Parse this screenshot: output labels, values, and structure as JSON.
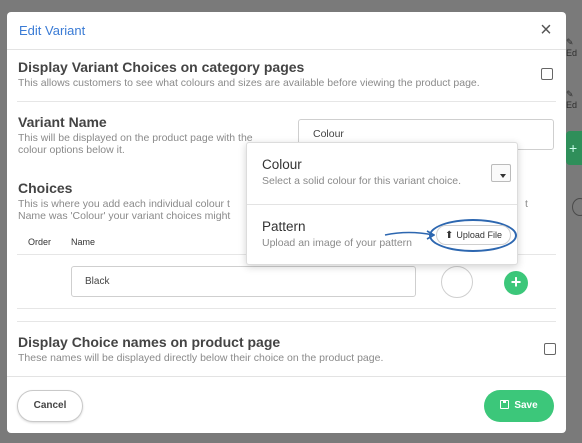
{
  "background": {
    "edit_label": "Ed"
  },
  "modal": {
    "title": "Edit Variant",
    "close_glyph": "×"
  },
  "display_choices": {
    "title": "Display Variant Choices on category pages",
    "description": "This allows customers to see what colours and sizes are available before viewing the product page.",
    "checked": false
  },
  "variant_name": {
    "title": "Variant Name",
    "description_line1": "This will be displayed on the product page with the",
    "description_line2": "colour options below it.",
    "value": "Colour"
  },
  "choices": {
    "title": "Choices",
    "description_line1": "This is where you add each individual colour t",
    "description_line2": "Name was 'Colour' your variant choices might",
    "description_tail": "t",
    "col_order": "Order",
    "col_name": "Name",
    "rows": [
      {
        "name": "Black"
      }
    ],
    "add_glyph": "+"
  },
  "popover": {
    "colour_title": "Colour",
    "colour_desc": "Select a solid colour for this variant choice.",
    "pattern_title": "Pattern",
    "pattern_desc": "Upload an image of your pattern",
    "upload_label": "Upload File"
  },
  "display_names": {
    "title": "Display Choice names on product page",
    "description": "These names will be displayed directly below their choice on the product page.",
    "checked": false
  },
  "footer": {
    "cancel_label": "Cancel",
    "save_label": "Save"
  },
  "colors": {
    "accent_blue": "#3a7bd5",
    "success_green": "#3cc77a",
    "annotation_blue": "#2d67b0"
  }
}
